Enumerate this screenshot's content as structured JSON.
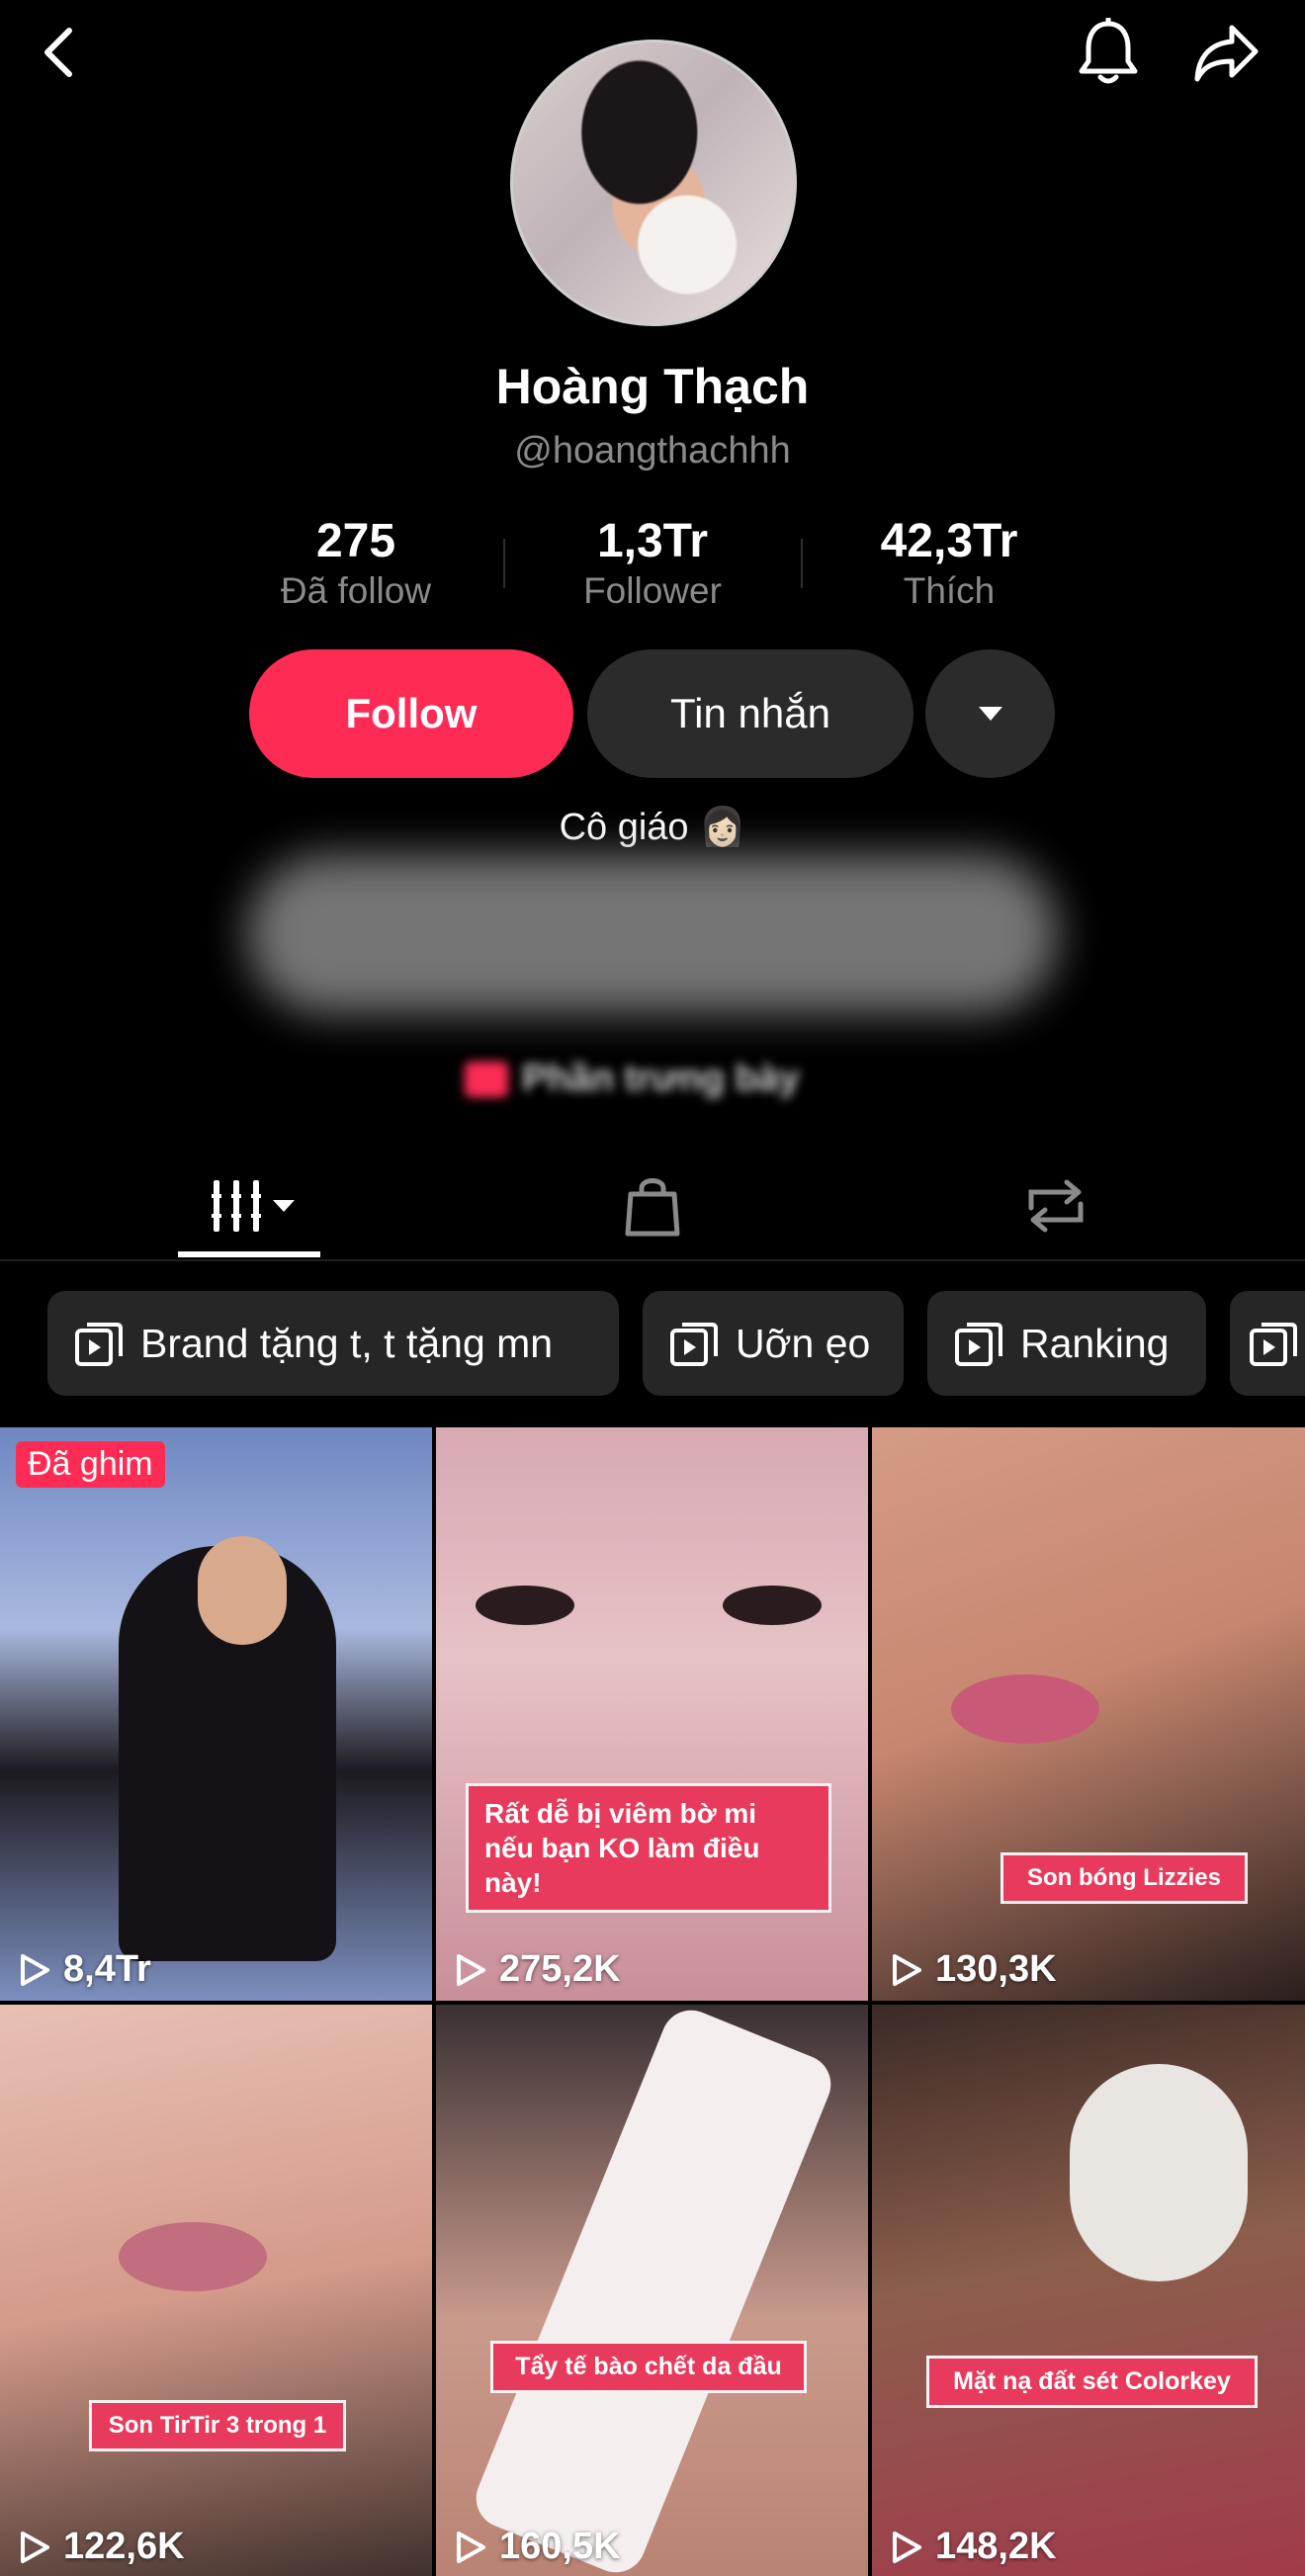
{
  "header": {
    "back_icon": "chevron-left-icon",
    "bell_icon": "bell-icon",
    "share_icon": "share-arrow-icon"
  },
  "profile": {
    "name": "Hoàng Thạch",
    "handle": "@hoangthachhh",
    "stats": [
      {
        "value": "275",
        "label": "Đã follow"
      },
      {
        "value": "1,3Tr",
        "label": "Follower"
      },
      {
        "value": "42,3Tr",
        "label": "Thích"
      }
    ],
    "follow_label": "Follow",
    "message_label": "Tin nhắn",
    "bio": "Cô giáo 👩🏻",
    "showcase_label": "Phần trưng bày"
  },
  "tabs": [
    {
      "icon": "grid-videos-icon",
      "selected": true
    },
    {
      "icon": "shopping-bag-icon",
      "selected": false
    },
    {
      "icon": "repost-icon",
      "selected": false
    }
  ],
  "playlists": [
    "Brand tặng t, t tặng mn",
    "Uỡn ẹo",
    "Ranking",
    ""
  ],
  "videos": [
    {
      "views": "8,4Tr",
      "pinned": "Đã ghim",
      "caption": ""
    },
    {
      "views": "275,2K",
      "caption": "Rất dễ bị viêm bờ mi\nnếu bạn KO làm điều này!"
    },
    {
      "views": "130,3K",
      "caption": "Son bóng Lizzies"
    },
    {
      "views": "122,6K",
      "caption": "Son TirTir 3 trong 1"
    },
    {
      "views": "160,5K",
      "caption": "Tẩy tế bào chết da đầu"
    },
    {
      "views": "148,2K",
      "caption": "Mặt nạ đất sét Colorkey"
    }
  ],
  "colors": {
    "accent": "#fe2c55",
    "background": "#000000",
    "secondary_button": "#2b2b2b"
  }
}
